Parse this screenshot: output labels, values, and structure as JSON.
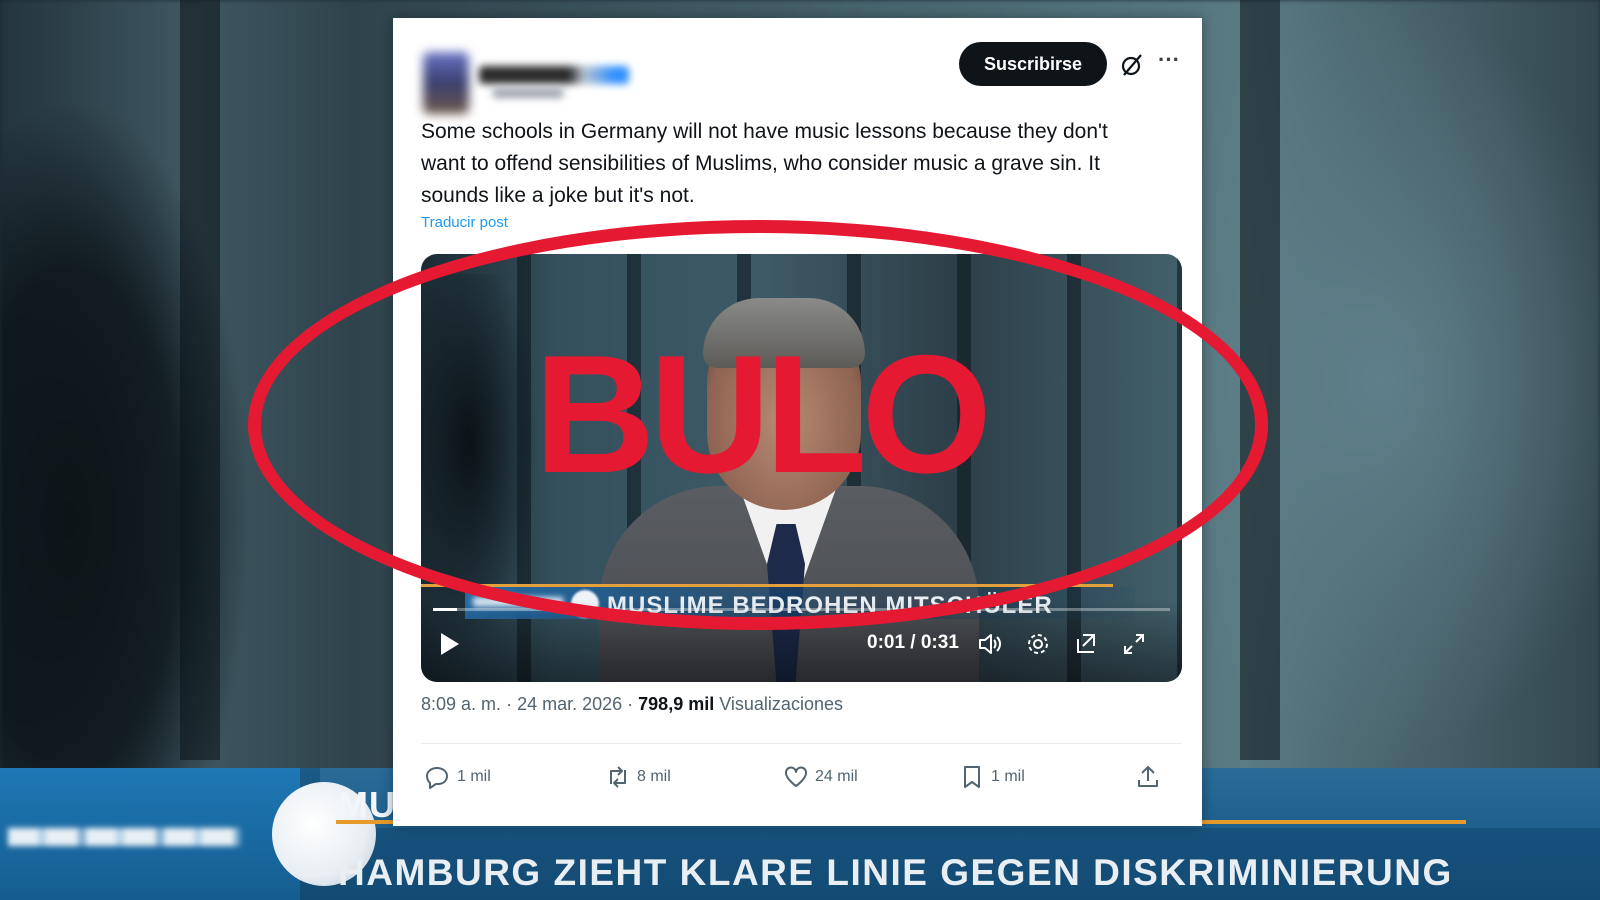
{
  "background": {
    "lower_third_top_text": "MU",
    "lower_third_headline": "HAMBURG ZIEHT KLARE LINIE GEGEN DISKRIMINIERUNG"
  },
  "tweet": {
    "subscribe_label": "Suscribirse",
    "text": "Some schools in Germany will not have music lessons because they don't want to offend sensibilities of Muslims, who consider music a grave sin. It sounds like a joke but it's not.",
    "translate_label": "Traducir post",
    "video": {
      "lower_third_text": "MUSLIME BEDROHEN MITSCHÜLER",
      "time": "0:01 / 0:31",
      "progress_fraction": 0.032
    },
    "meta": {
      "time": "8:09 a. m.",
      "date": "24 mar. 2026",
      "views_count": "798,9 mil",
      "views_label": "Visualizaciones"
    },
    "actions": {
      "replies": "1 mil",
      "reposts": "8 mil",
      "likes": "24 mil",
      "bookmarks": "1 mil"
    }
  },
  "stamp": {
    "text": "BULO",
    "color": "#e51a32"
  }
}
